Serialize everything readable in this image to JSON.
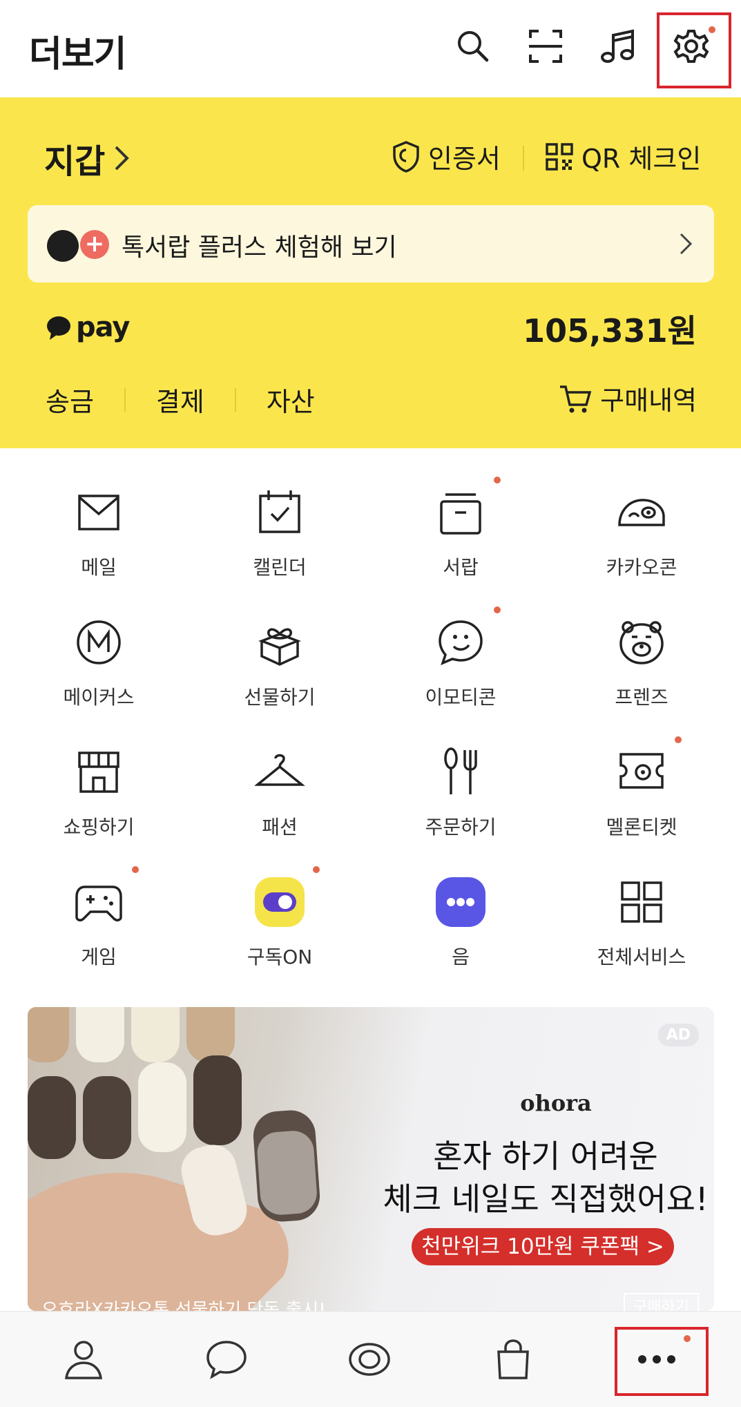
{
  "header": {
    "title": "더보기",
    "icons": [
      "search-icon",
      "scan-icon",
      "music-icon",
      "settings-icon"
    ]
  },
  "wallet": {
    "title": "지갑",
    "cert_label": "인증서",
    "qr_label": "QR 체크인",
    "plus_banner": "톡서랍 플러스 체험해 보기",
    "pay_label": "pay",
    "balance": "105,331원",
    "tabs": [
      "송금",
      "결제",
      "자산"
    ],
    "orders_label": "구매내역"
  },
  "services": [
    {
      "label": "메일",
      "icon": "mail-icon",
      "badge": false
    },
    {
      "label": "캘린더",
      "icon": "calendar-icon",
      "badge": false
    },
    {
      "label": "서랍",
      "icon": "drawer-icon",
      "badge": true
    },
    {
      "label": "카카오콘",
      "icon": "kakaocon-icon",
      "badge": false
    },
    {
      "label": "메이커스",
      "icon": "makers-icon",
      "badge": false
    },
    {
      "label": "선물하기",
      "icon": "gift-icon",
      "badge": false
    },
    {
      "label": "이모티콘",
      "icon": "emoticon-icon",
      "badge": true
    },
    {
      "label": "프렌즈",
      "icon": "friends-icon",
      "badge": false
    },
    {
      "label": "쇼핑하기",
      "icon": "shop-icon",
      "badge": false
    },
    {
      "label": "패션",
      "icon": "hanger-icon",
      "badge": false
    },
    {
      "label": "주문하기",
      "icon": "fork-icon",
      "badge": false
    },
    {
      "label": "멜론티켓",
      "icon": "ticket-icon",
      "badge": true
    },
    {
      "label": "게임",
      "icon": "gamepad-icon",
      "badge": true
    },
    {
      "label": "구독ON",
      "icon": "subscribe-on-icon",
      "badge": true
    },
    {
      "label": "음",
      "icon": "eum-icon",
      "badge": false
    },
    {
      "label": "전체서비스",
      "icon": "all-services-icon",
      "badge": false
    }
  ],
  "ad": {
    "tag": "AD",
    "brand": "ohora",
    "line1": "혼자 하기 어려운",
    "line2": "체크 네일도 직접했어요!",
    "cta": "천만위크 10만원 쿠폰팩 >",
    "caption": "오호라X카카오톡 선물하기 단독 출시!",
    "shop_label": "구매하기"
  },
  "bottom_nav": [
    "friends-tab-icon",
    "chats-tab-icon",
    "view-tab-icon",
    "shopping-tab-icon",
    "more-tab-icon"
  ],
  "colors": {
    "wallet_bg": "#fae64c",
    "badge": "#e2674a",
    "highlight": "#d9252d"
  }
}
